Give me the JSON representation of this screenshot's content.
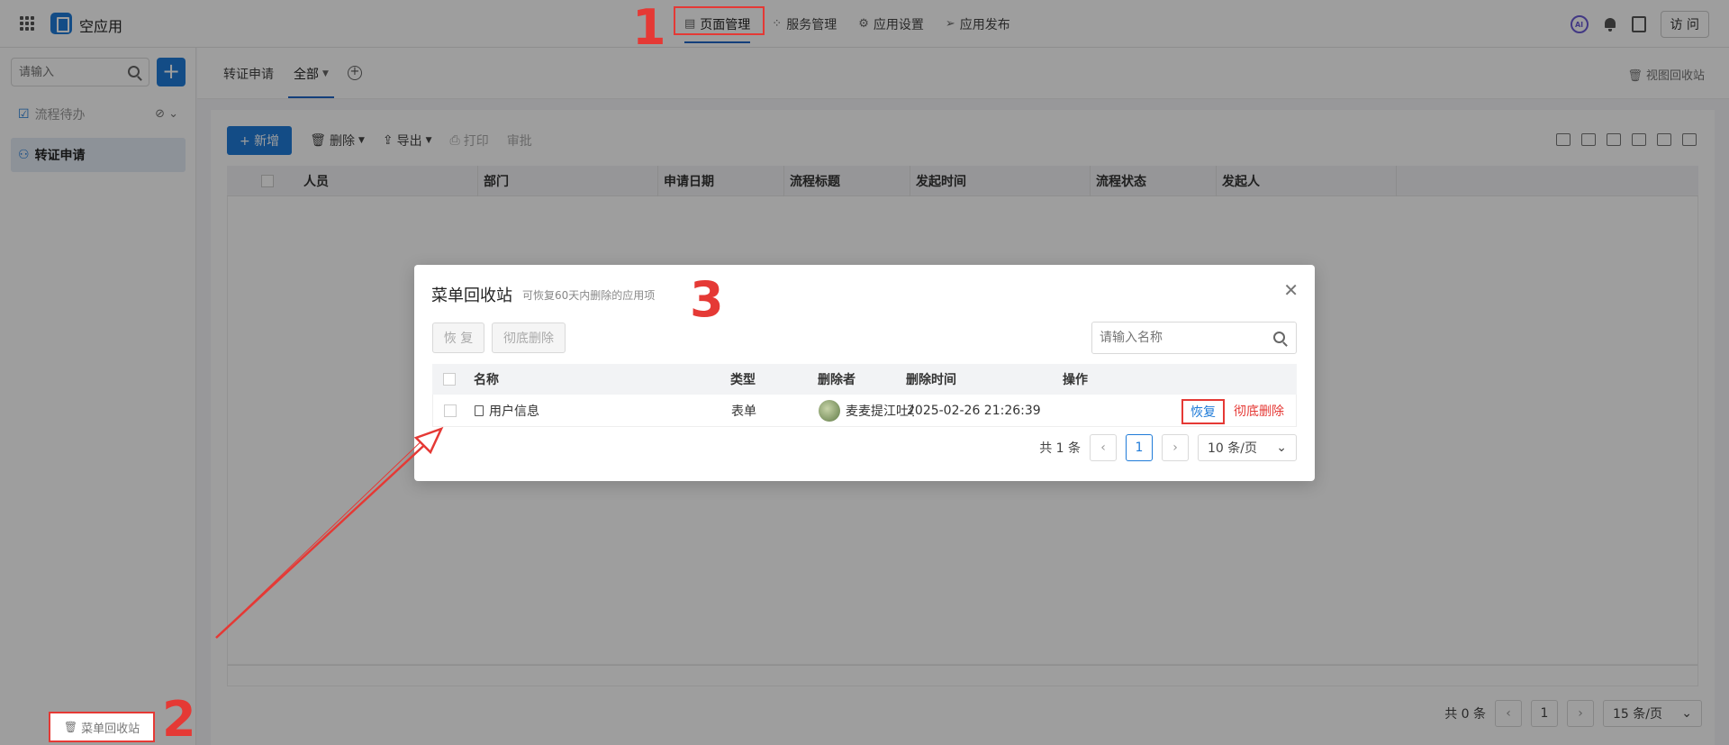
{
  "app": {
    "name": "空应用"
  },
  "topnav": [
    {
      "label": "页面管理",
      "icon": "page-icon"
    },
    {
      "label": "服务管理",
      "icon": "service-icon"
    },
    {
      "label": "应用设置",
      "icon": "gear-icon"
    },
    {
      "label": "应用发布",
      "icon": "send-icon"
    }
  ],
  "topright": {
    "ai": "AI",
    "visit": "访 问"
  },
  "sidebar": {
    "search_placeholder": "请输入",
    "items": [
      {
        "label": "流程待办",
        "icon": "calendar-check-icon"
      },
      {
        "label": "转证申请",
        "icon": "org-chart-icon"
      }
    ],
    "recycle": "菜单回收站"
  },
  "tabs": {
    "t1": "转证申请",
    "t2": "全部",
    "view_recycle": "视图回收站"
  },
  "toolbar": {
    "add": "+ 新增",
    "delete": "删除",
    "export": "导出",
    "print": "打印",
    "approve": "审批"
  },
  "grid": {
    "columns": [
      "人员",
      "部门",
      "申请日期",
      "流程标题",
      "发起时间",
      "流程状态",
      "发起人"
    ]
  },
  "main_pager": {
    "total": "共 0 条",
    "page": "1",
    "size": "15 条/页"
  },
  "modal": {
    "title": "菜单回收站",
    "subtitle": "可恢复60天内删除的应用项",
    "restore_btn": "恢 复",
    "purge_btn": "彻底删除",
    "search_placeholder": "请输入名称",
    "columns": {
      "name": "名称",
      "type": "类型",
      "deleter": "删除者",
      "time": "删除时间",
      "ops": "操作"
    },
    "rows": [
      {
        "name": "用户信息",
        "type": "表单",
        "deleter": "麦麦提江吐尔",
        "time": "2025-02-26 21:26:39",
        "restore": "恢复",
        "purge": "彻底删除"
      }
    ],
    "pager": {
      "total": "共 1 条",
      "page": "1",
      "size": "10 条/页"
    }
  },
  "callouts": [
    "1",
    "2",
    "3"
  ],
  "colors": {
    "accent": "#1f7bd8",
    "annotation": "#e53935"
  }
}
